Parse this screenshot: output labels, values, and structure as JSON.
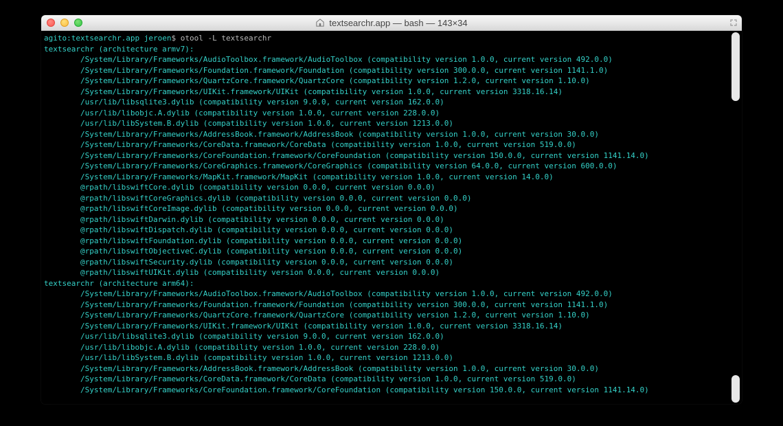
{
  "window": {
    "title": "textsearchr.app — bash — 143×34"
  },
  "prompt": {
    "host": "agito",
    "cwd": "textsearchr.app",
    "user": "jeroen",
    "symbol": "$",
    "command": "otool -L textsearchr"
  },
  "output": {
    "binary": "textsearchr",
    "architectures": [
      {
        "name": "armv7",
        "libs": [
          {
            "path": "/System/Library/Frameworks/AudioToolbox.framework/AudioToolbox",
            "compat": "1.0.0",
            "current": "492.0.0"
          },
          {
            "path": "/System/Library/Frameworks/Foundation.framework/Foundation",
            "compat": "300.0.0",
            "current": "1141.1.0"
          },
          {
            "path": "/System/Library/Frameworks/QuartzCore.framework/QuartzCore",
            "compat": "1.2.0",
            "current": "1.10.0"
          },
          {
            "path": "/System/Library/Frameworks/UIKit.framework/UIKit",
            "compat": "1.0.0",
            "current": "3318.16.14"
          },
          {
            "path": "/usr/lib/libsqlite3.dylib",
            "compat": "9.0.0",
            "current": "162.0.0"
          },
          {
            "path": "/usr/lib/libobjc.A.dylib",
            "compat": "1.0.0",
            "current": "228.0.0"
          },
          {
            "path": "/usr/lib/libSystem.B.dylib",
            "compat": "1.0.0",
            "current": "1213.0.0"
          },
          {
            "path": "/System/Library/Frameworks/AddressBook.framework/AddressBook",
            "compat": "1.0.0",
            "current": "30.0.0"
          },
          {
            "path": "/System/Library/Frameworks/CoreData.framework/CoreData",
            "compat": "1.0.0",
            "current": "519.0.0"
          },
          {
            "path": "/System/Library/Frameworks/CoreFoundation.framework/CoreFoundation",
            "compat": "150.0.0",
            "current": "1141.14.0"
          },
          {
            "path": "/System/Library/Frameworks/CoreGraphics.framework/CoreGraphics",
            "compat": "64.0.0",
            "current": "600.0.0"
          },
          {
            "path": "/System/Library/Frameworks/MapKit.framework/MapKit",
            "compat": "1.0.0",
            "current": "14.0.0"
          },
          {
            "path": "@rpath/libswiftCore.dylib",
            "compat": "0.0.0",
            "current": "0.0.0"
          },
          {
            "path": "@rpath/libswiftCoreGraphics.dylib",
            "compat": "0.0.0",
            "current": "0.0.0"
          },
          {
            "path": "@rpath/libswiftCoreImage.dylib",
            "compat": "0.0.0",
            "current": "0.0.0"
          },
          {
            "path": "@rpath/libswiftDarwin.dylib",
            "compat": "0.0.0",
            "current": "0.0.0"
          },
          {
            "path": "@rpath/libswiftDispatch.dylib",
            "compat": "0.0.0",
            "current": "0.0.0"
          },
          {
            "path": "@rpath/libswiftFoundation.dylib",
            "compat": "0.0.0",
            "current": "0.0.0"
          },
          {
            "path": "@rpath/libswiftObjectiveC.dylib",
            "compat": "0.0.0",
            "current": "0.0.0"
          },
          {
            "path": "@rpath/libswiftSecurity.dylib",
            "compat": "0.0.0",
            "current": "0.0.0"
          },
          {
            "path": "@rpath/libswiftUIKit.dylib",
            "compat": "0.0.0",
            "current": "0.0.0"
          }
        ]
      },
      {
        "name": "arm64",
        "libs": [
          {
            "path": "/System/Library/Frameworks/AudioToolbox.framework/AudioToolbox",
            "compat": "1.0.0",
            "current": "492.0.0"
          },
          {
            "path": "/System/Library/Frameworks/Foundation.framework/Foundation",
            "compat": "300.0.0",
            "current": "1141.1.0"
          },
          {
            "path": "/System/Library/Frameworks/QuartzCore.framework/QuartzCore",
            "compat": "1.2.0",
            "current": "1.10.0"
          },
          {
            "path": "/System/Library/Frameworks/UIKit.framework/UIKit",
            "compat": "1.0.0",
            "current": "3318.16.14"
          },
          {
            "path": "/usr/lib/libsqlite3.dylib",
            "compat": "9.0.0",
            "current": "162.0.0"
          },
          {
            "path": "/usr/lib/libobjc.A.dylib",
            "compat": "1.0.0",
            "current": "228.0.0"
          },
          {
            "path": "/usr/lib/libSystem.B.dylib",
            "compat": "1.0.0",
            "current": "1213.0.0"
          },
          {
            "path": "/System/Library/Frameworks/AddressBook.framework/AddressBook",
            "compat": "1.0.0",
            "current": "30.0.0"
          },
          {
            "path": "/System/Library/Frameworks/CoreData.framework/CoreData",
            "compat": "1.0.0",
            "current": "519.0.0"
          },
          {
            "path": "/System/Library/Frameworks/CoreFoundation.framework/CoreFoundation",
            "compat": "150.0.0",
            "current": "1141.14.0"
          }
        ]
      }
    ]
  }
}
